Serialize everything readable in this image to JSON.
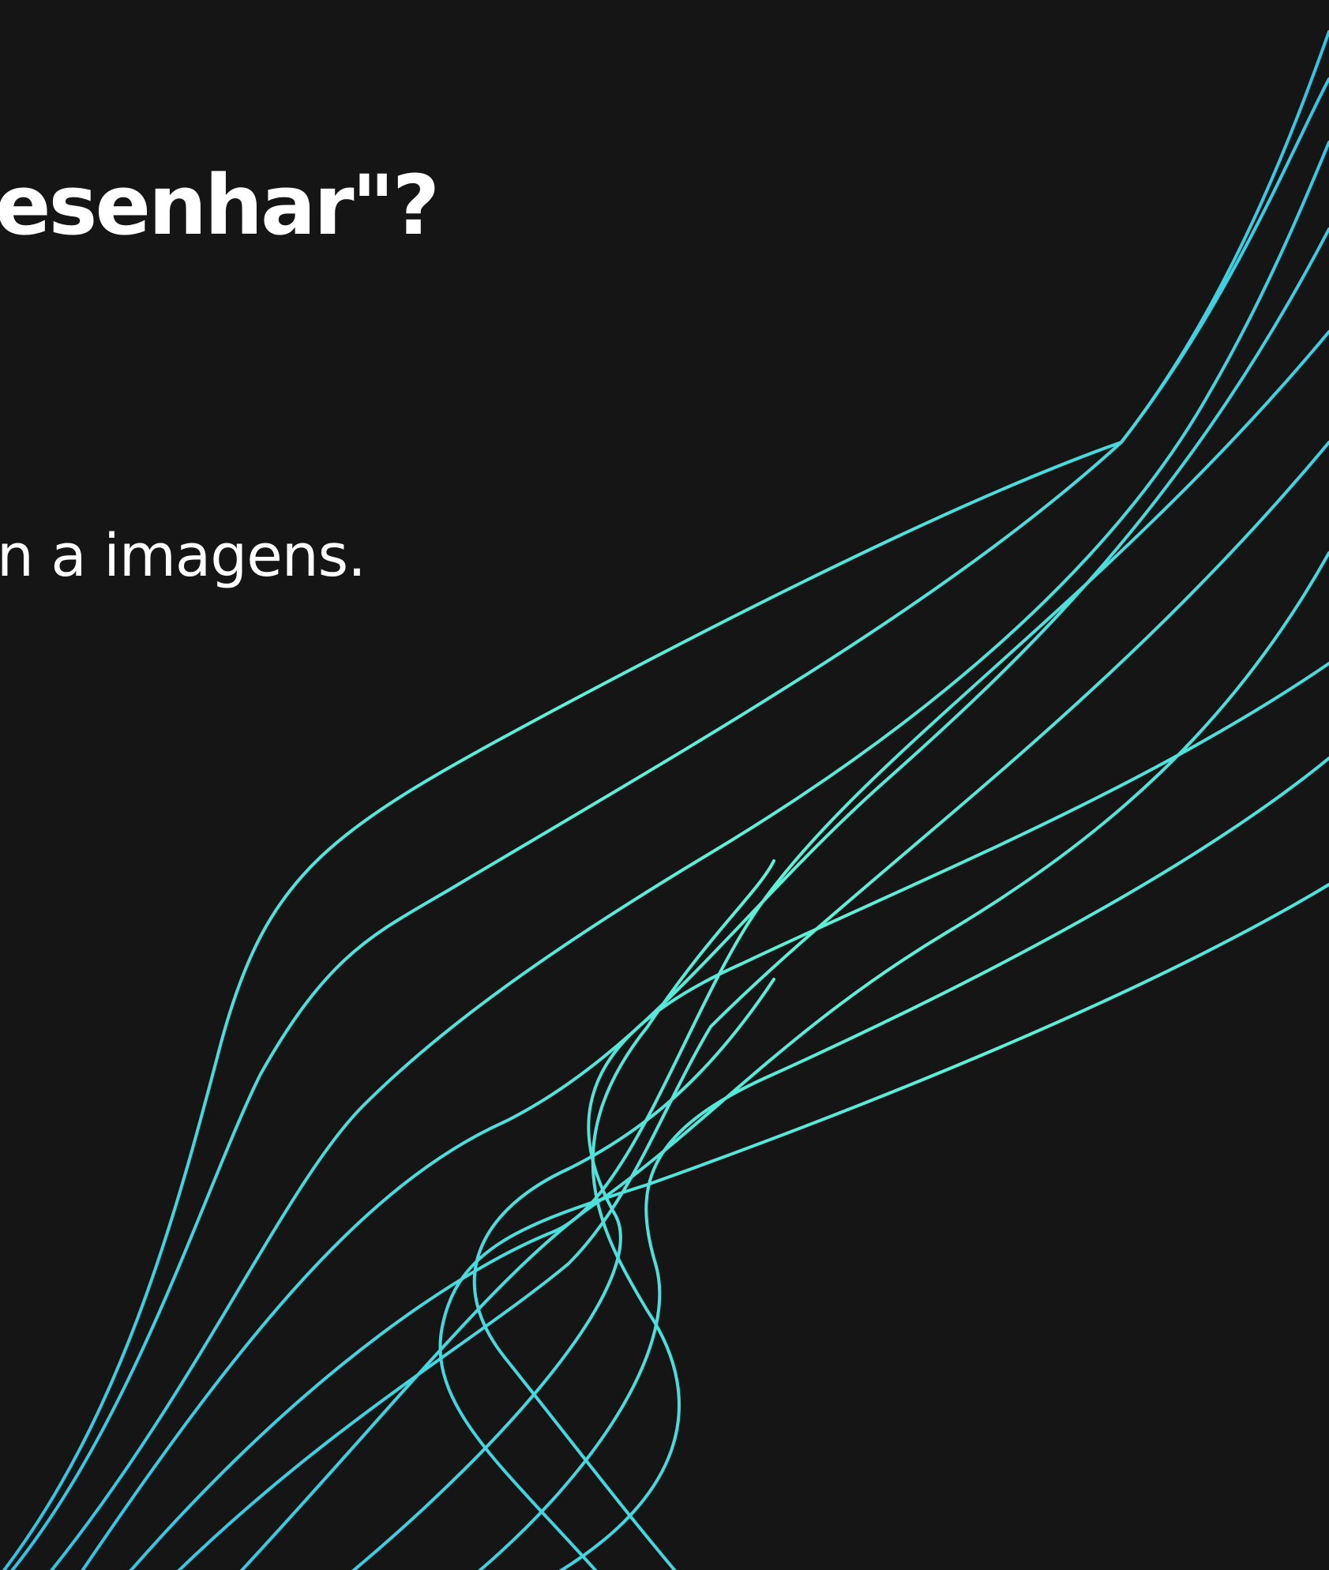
{
  "slide": {
    "heading_fragment": "esenhar\"?",
    "body_fragment": "n a imagens."
  },
  "decoration": {
    "icon": "flowing-wave-lines",
    "line_count": 12,
    "colors": {
      "background": "#151515",
      "text": "#ffffff",
      "line_light": "#5ef2d6",
      "line_mid": "#4ae0e0",
      "line_deep": "#2fc3e6"
    }
  }
}
